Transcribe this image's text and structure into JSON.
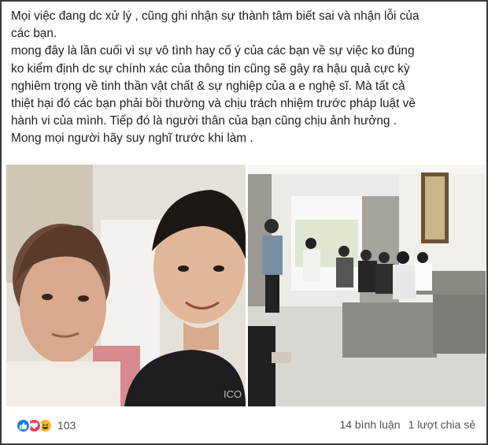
{
  "post": {
    "lines": [
      "Mọi việc đang dc xử lý , cũng ghi nhận sự thành tâm biết sai và nhận lỗi của",
      "các bạn.",
      "mong đây là lần cuối vì sự vô tình hay cố ý của các bạn về sự việc ko đúng",
      "ko kiểm định dc sự chính xác của thông tin cũng sẽ gây ra hậu quả cực kỳ",
      "nghiêm trọng về tinh thần vật chất & sự nghiệp của a e nghệ sĩ. Mà tất cả",
      "thiệt hại đó các bạn phải bồi thường và chịu trách nhiệm trước pháp luật về",
      "hành vi của mình. Tiếp đó là người thân của bạn cũng chịu ảnh hưởng .",
      "Mong mọi người hãy suy nghĩ trước khi làm ."
    ]
  },
  "photos": {
    "left_overlay_text": "ICO"
  },
  "footer": {
    "reaction_icons": [
      "like-icon",
      "love-icon",
      "haha-icon"
    ],
    "reaction_count": "103",
    "comments": "14 bình luận",
    "shares": "1 lượt chia sẻ"
  },
  "colors": {
    "like": "#1877f2",
    "love": "#f33e58",
    "haha": "#f7b928",
    "text": "#1c1e21",
    "muted": "#4b4f56"
  }
}
